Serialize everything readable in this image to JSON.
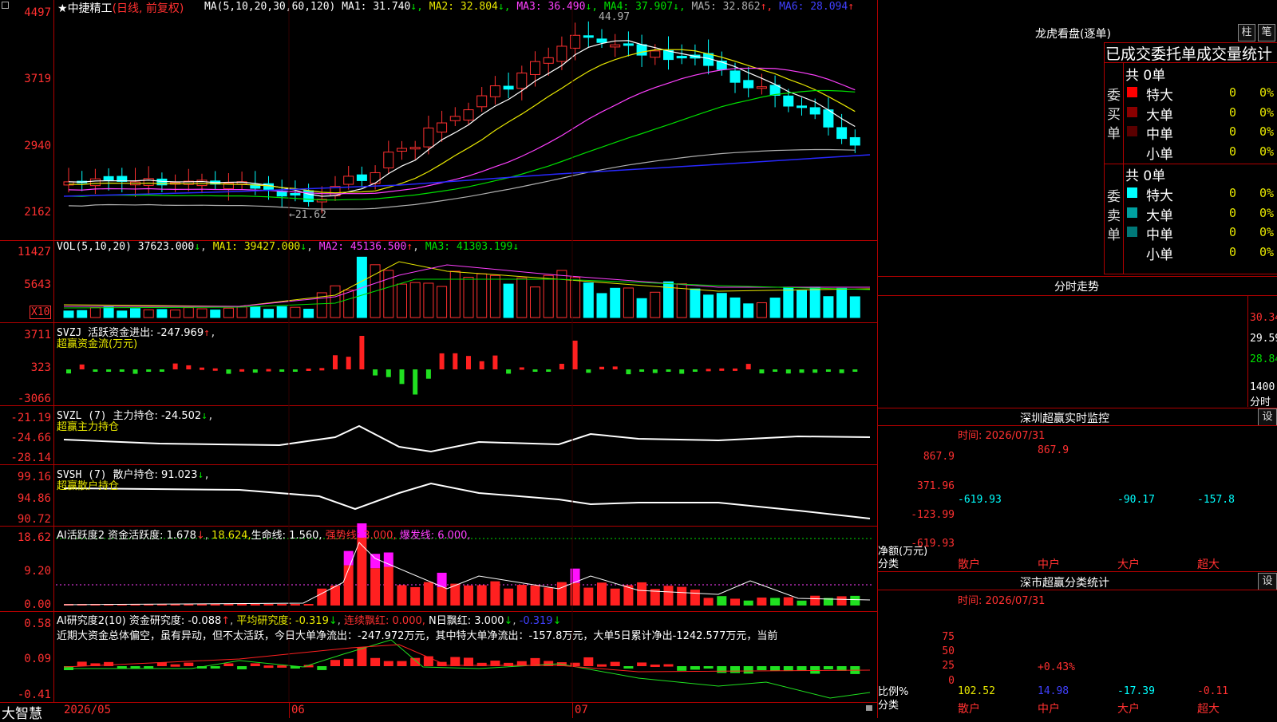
{
  "stock": {
    "star": "★",
    "name": "中捷精工",
    "mode": "(日线, 前复权)"
  },
  "ma_header": {
    "label": "MA(5,10,20,30,60,120)",
    "items": [
      {
        "t": "MA1: 31.740",
        "a": "↓",
        "c": "#ffffff"
      },
      {
        "t": "MA2: 32.804",
        "a": "↓",
        "c": "#e8e800"
      },
      {
        "t": "MA3: 36.490",
        "a": "↓",
        "c": "#ff40ff"
      },
      {
        "t": "MA4: 37.907",
        "a": "↓",
        "c": "#00e000"
      },
      {
        "t": "MA5: 32.862",
        "a": "↑",
        "c": "#b0b0b0"
      },
      {
        "t": "MA6: 28.094",
        "a": "↑",
        "c": "#4040ff"
      }
    ]
  },
  "price_axis": [
    "4497",
    "3719",
    "2940",
    "2162"
  ],
  "high_mark": "44.97",
  "low_mark": "←21.62",
  "vol": {
    "label": "VOL(5,10,20)",
    "v": "37623.000",
    "ma1": "MA1: 39427.000",
    "ma2": "MA2: 45136.500",
    "ma3": "MA3: 41303.199",
    "axis": [
      "11427",
      "5643"
    ],
    "unit": "X10"
  },
  "svzj": {
    "label": "SVZJ",
    "title": "活跃资金进出: -247.969",
    "sub": "超赢资金流(万元)",
    "axis": [
      "3711",
      "323",
      "-3066"
    ]
  },
  "svzl": {
    "label": "SVZL (7)",
    "title": "主力持仓: -24.502",
    "sub": "超赢主力持仓",
    "axis": [
      "-21.19",
      "-24.66",
      "-28.14"
    ]
  },
  "svsh": {
    "label": "SVSH (7)",
    "title": "散户持仓: 91.023",
    "sub": "超赢散户持仓",
    "axis": [
      "99.16",
      "94.86",
      "90.72"
    ]
  },
  "ai1": {
    "label": "AI活跃度2",
    "t1": "资金活跃度: 1.678",
    "t2": "18.624,",
    "t3": "生命线: 1.560,",
    "t4": "强势线: 3.000,",
    "t5": "爆发线: 6.000,",
    "axis": [
      "18.62",
      "9.20",
      "0.00"
    ]
  },
  "ai2": {
    "label": "AI研究度2(10)",
    "t1": "资金研究度: -0.088",
    "t2": "平均研究度: -0.319",
    "t3": "连续飘红: 0.000,",
    "t4": "N日飘红: 3.000",
    "t5": "-0.319",
    "axis": [
      "0.58",
      "0.09",
      "-0.41"
    ],
    "desc": "近期大资金总体偏空，虽有异动，但不太活跃，今日大单净流出：-247.972万元，其中特大单净流出：-157.8万元，大单5日累计净出-1242.577万元，当前"
  },
  "xaxis": {
    "brand": "大智慧",
    "d1": "2026/05",
    "d2": "06",
    "d3": "07"
  },
  "right": {
    "lhb": {
      "title": "龙虎看盘(逐单)",
      "btn1": "柱",
      "btn2": "笔",
      "cap": "已成交委托单成交量统计",
      "buy": {
        "side": "委买单",
        "total": "共 0单",
        "rows": [
          {
            "n": "特大",
            "c": "#ff0000",
            "v": "0",
            "p": "0%"
          },
          {
            "n": "大单",
            "c": "#8b0000",
            "v": "0",
            "p": "0%"
          },
          {
            "n": "中单",
            "c": "#5a0000",
            "v": "0",
            "p": "0%"
          },
          {
            "n": "小单",
            "c": "",
            "v": "0",
            "p": "0%"
          }
        ]
      },
      "sell": {
        "side": "委卖单",
        "total": "共 0单",
        "rows": [
          {
            "n": "特大",
            "c": "#00ffff",
            "v": "0",
            "p": "0%"
          },
          {
            "n": "大单",
            "c": "#00a0a0",
            "v": "0",
            "p": "0%"
          },
          {
            "n": "中单",
            "c": "#007878",
            "v": "0",
            "p": "0%"
          },
          {
            "n": "小单",
            "c": "",
            "v": "0",
            "p": "0%"
          }
        ]
      }
    },
    "fs": {
      "title": "分时走势",
      "p1": "30.34",
      "p2": "29.59",
      "p3": "28.84",
      "vol": "1400",
      "vlabel": "分时"
    },
    "sz": {
      "title": "深圳超赢实时监控",
      "btn": "设",
      "time": "时间: 2026/07/31",
      "axis": [
        "867.9",
        "371.96",
        "-123.99",
        "-619.93"
      ],
      "vals": [
        "-619.93",
        "867.9",
        "-90.17",
        "-157.8"
      ],
      "ylabel": "净额(万元)",
      "xlabel": "分类",
      "cats": [
        "散户",
        "中户",
        "大户",
        "超大"
      ]
    },
    "ss": {
      "title": "深市超赢分类统计",
      "btn": "设",
      "time": "时间: 2026/07/31",
      "axis": [
        "75",
        "50",
        "25",
        "0"
      ],
      "vals": [
        "102.52",
        "14.98",
        "-17.39",
        "-0.11"
      ],
      "extra": "+0.43%",
      "ylabel": "比例%",
      "xlabel": "分类",
      "cats": [
        "散户",
        "中户",
        "大户",
        "超大"
      ]
    }
  }
}
